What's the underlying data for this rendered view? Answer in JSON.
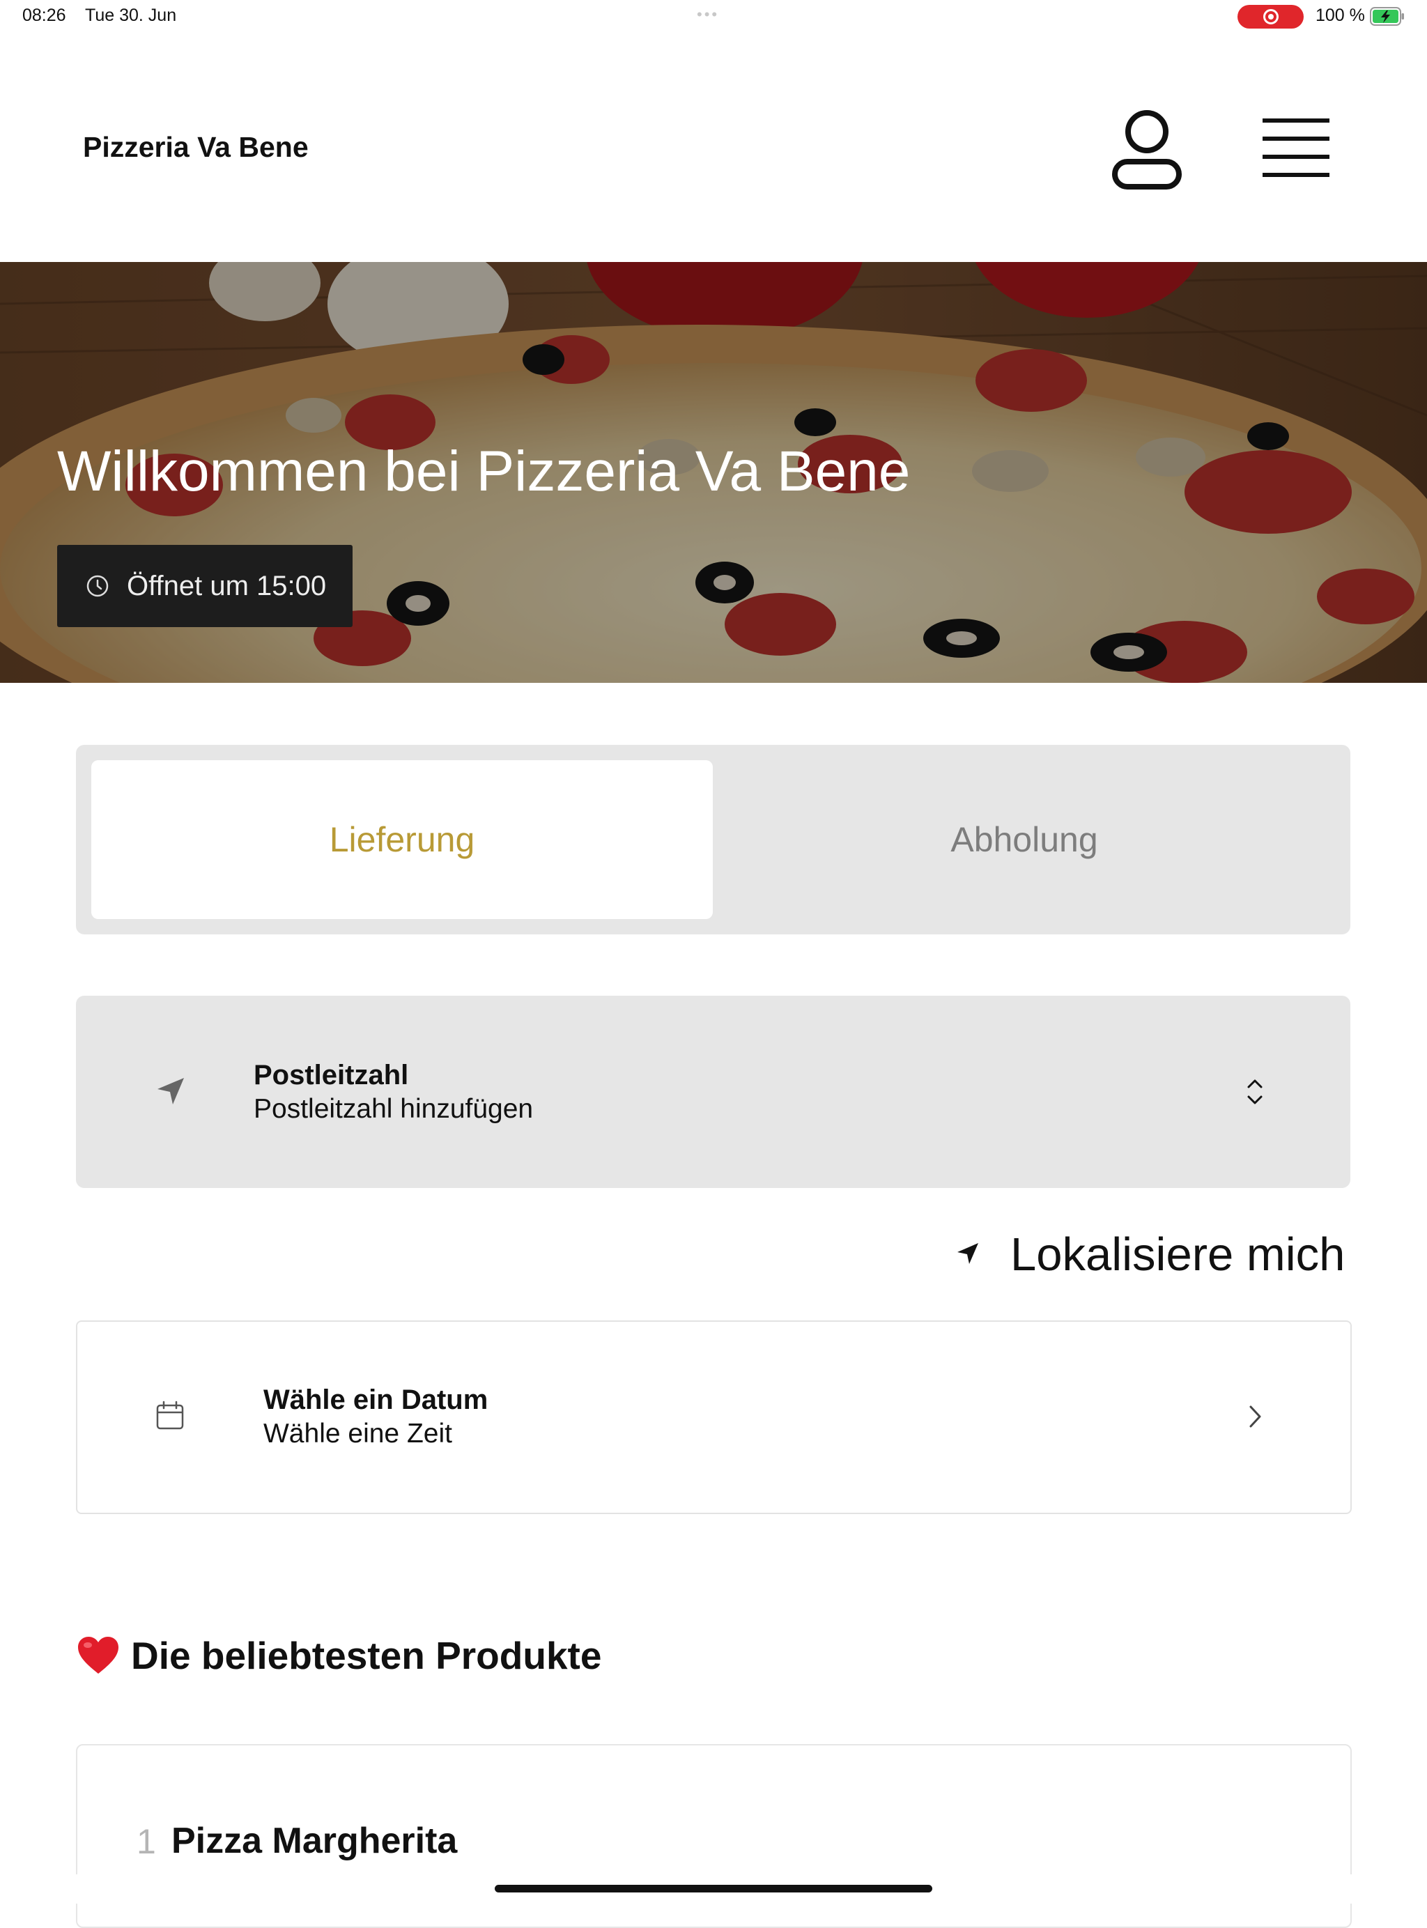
{
  "status_bar": {
    "time": "08:26",
    "date": "Tue 30. Jun",
    "battery_percent": "100 %",
    "multitask_dots": "•••",
    "recording_active": true,
    "battery_level": 1.0,
    "battery_charging": true
  },
  "header": {
    "brand": "Pizzeria Va Bene",
    "profile_icon": "person-outline-icon",
    "menu_icon": "hamburger-menu-icon"
  },
  "hero": {
    "title": "Willkommen bei Pizzeria Va Bene",
    "hours_text": "Öffnet um 15:00",
    "hours_icon": "clock-icon"
  },
  "order_mode": {
    "options": [
      "Lieferung",
      "Abholung"
    ],
    "selected": "Lieferung",
    "accent_color": "#b89a36"
  },
  "postcode": {
    "title": "Postleitzahl",
    "placeholder": "Postleitzahl hinzufügen",
    "icon": "location-arrow-icon",
    "chevron_icon": "chevron-up-down-icon"
  },
  "locate_me": {
    "label": "Lokalisiere mich",
    "icon": "location-arrow-icon"
  },
  "schedule": {
    "title": "Wähle ein Datum",
    "subtitle": "Wähle eine Zeit",
    "icon": "calendar-icon",
    "chevron_icon": "chevron-right-icon"
  },
  "popular": {
    "emoji": "❤️",
    "title": "Die beliebtesten Produkte",
    "items": [
      {
        "rank": "1",
        "name": "Pizza Margherita"
      }
    ]
  }
}
